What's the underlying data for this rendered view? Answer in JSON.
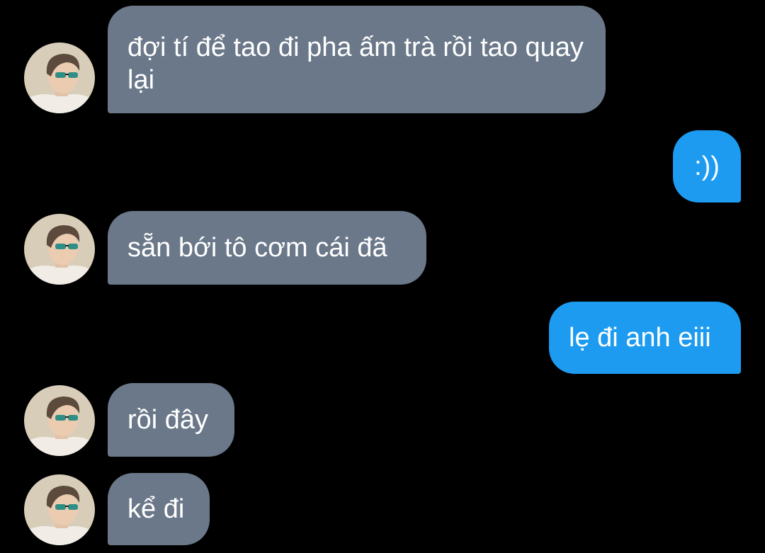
{
  "colors": {
    "background": "#000000",
    "incoming_bubble": "#6a7889",
    "outgoing_bubble": "#1d9bf0",
    "text": "#ffffff"
  },
  "messages": [
    {
      "direction": "incoming",
      "text": "đợi tí để tao đi pha ấm trà rồi tao quay lại",
      "avatar": "user-avatar"
    },
    {
      "direction": "outgoing",
      "text": ":))"
    },
    {
      "direction": "incoming",
      "text": "sẵn bới tô cơm cái đã",
      "avatar": "user-avatar"
    },
    {
      "direction": "outgoing",
      "text": "lẹ đi anh eiii"
    },
    {
      "direction": "incoming",
      "text": "rồi đây",
      "avatar": "user-avatar"
    },
    {
      "direction": "incoming",
      "text": "kể đi",
      "avatar": "user-avatar"
    }
  ]
}
